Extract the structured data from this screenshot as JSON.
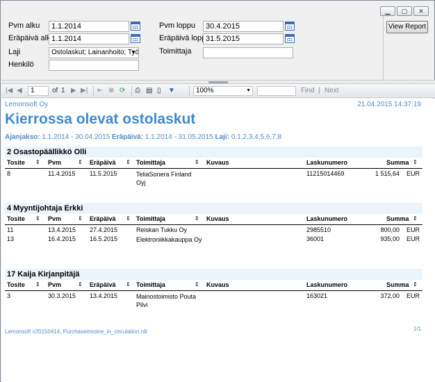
{
  "window": {
    "minimize_icon": "minimize-icon",
    "maximize_icon": "maximize-icon",
    "close_icon": "close-icon"
  },
  "params": {
    "pvm_alku_label": "Pvm alku",
    "pvm_alku_value": "1.1.2014",
    "pvm_loppu_label": "Pvm loppu",
    "pvm_loppu_value": "30.4.2015",
    "erapaiva_alku_label": "Eräpäivä alku",
    "erapaiva_alku_value": "1.1.2014",
    "erapaiva_loppu_label": "Eräpäivä loppu",
    "erapaiva_loppu_value": "31.5.2015",
    "laji_label": "Laji",
    "laji_value": "Ostolaskut; Lainanhoito; Työna",
    "toimittaja_label": "Toimittaja",
    "toimittaja_value": "",
    "henkilo_label": "Henkilö",
    "henkilo_value": "",
    "view_report_label": "View Report"
  },
  "toolbar": {
    "page_value": "1",
    "of_label": "of",
    "total_pages": "1",
    "zoom_value": "100%",
    "find_label": "Find",
    "separator": "|",
    "next_label": "Next"
  },
  "report": {
    "company": "Lemonsoft Oy",
    "datetime": "21.04.2015 14:37:19",
    "title": "Kierrossa olevat ostolaskut",
    "period_label": "Ajanjakso:",
    "period_value": "1.1.2014 - 30.04.2015",
    "due_label": "Eräpäivä:",
    "due_value": "1.1.2014 - 31.05.2015",
    "type_label": "Laji:",
    "type_value": "0,1,2,3,4,5,6,7,8",
    "columns": {
      "tosite": "Tosite",
      "pvm": "Pvm",
      "erapaiva": "Eräpäivä",
      "toimittaja": "Toimittaja",
      "kuvaus": "Kuvaus",
      "laskunumero": "Laskunumero",
      "summa": "Summa"
    },
    "sort_icon": "⇕",
    "groups": [
      {
        "name": "2 Osastopäällikkö Olli",
        "rows": [
          {
            "tosite": "8",
            "pvm": "11.4.2015",
            "erapaiva": "11.5.2015",
            "toimittaja": "TeliaSonera Finland Oyj",
            "kuvaus": "",
            "laskunumero": "11215014469",
            "summa": "1 515,64",
            "currency": "EUR"
          }
        ]
      },
      {
        "name": "4 Myyntijohtaja Erkki",
        "rows": [
          {
            "tosite": "11",
            "pvm": "13.4.2015",
            "erapaiva": "27.4.2015",
            "toimittaja": "Reiskan Tukku Oy",
            "kuvaus": "",
            "laskunumero": "2985510",
            "summa": "800,00",
            "currency": "EUR"
          },
          {
            "tosite": "13",
            "pvm": "16.4.2015",
            "erapaiva": "16.5.2015",
            "toimittaja": "Elektroniikkakauppa Oy",
            "kuvaus": "",
            "laskunumero": "36001",
            "summa": "935,00",
            "currency": "EUR"
          }
        ]
      },
      {
        "name": "17 Kaija Kirjanpitäjä",
        "rows": [
          {
            "tosite": "3",
            "pvm": "30.3.2015",
            "erapaiva": "13.4.2015",
            "toimittaja": "Mainostoimisto Pouta Pilvi",
            "kuvaus": "",
            "laskunumero": "163021",
            "summa": "372,00",
            "currency": "EUR"
          }
        ]
      }
    ],
    "footer": "Lemonsoft v20150414, Purchaseinvoice_in_circulation.rdl",
    "page_of": "1/1"
  }
}
